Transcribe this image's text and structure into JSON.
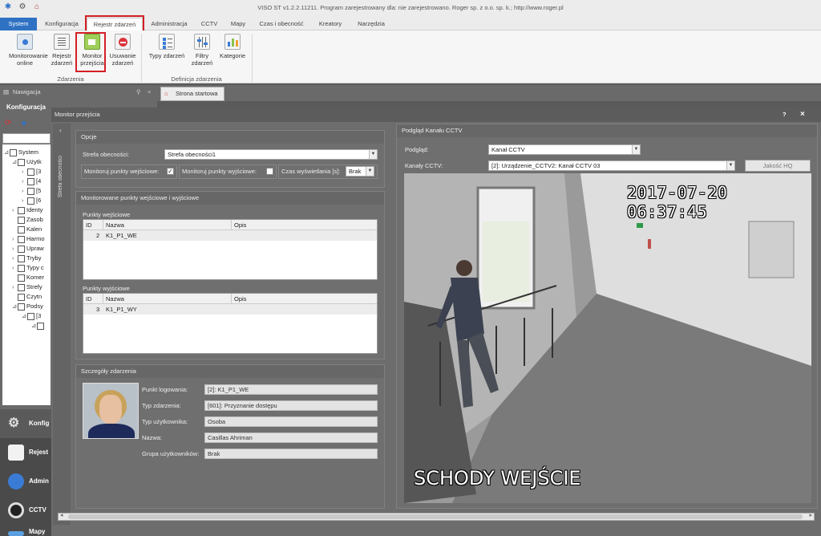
{
  "window": {
    "title": "VISO ST v1.2.2.11211. Program zarejestrowany dla: nie zarejestrowano. Roger sp. z o.o. sp. k.; http://www.roger.pl"
  },
  "menu": {
    "tabs": [
      "System",
      "Konfiguracja",
      "Rejestr zdarzeń",
      "Administracja",
      "CCTV",
      "Mapy",
      "Czas i obecność",
      "Kreatory",
      "Narzędzia"
    ]
  },
  "ribbon": {
    "buttons": [
      "Monitorowanie online",
      "Rejestr zdarzeń",
      "Monitor przejścia",
      "Usuwanie zdarzeń",
      "Typy zdarzeń",
      "Filtry zdarzeń",
      "Kategorie"
    ],
    "group1": "Zdarzenia",
    "group2": "Definicja zdarzenia"
  },
  "nav": {
    "title": "Nawigacja",
    "subtitle": "Konfiguracja",
    "tree": [
      "System",
      "Użytk",
      "[3",
      "[4",
      "[5",
      "[6",
      "Identy",
      "Zasob",
      "Kalen",
      "Harmo",
      "Upraw",
      "Tryby",
      "Typy c",
      "Komer",
      "Strefy",
      "Czytn",
      "Podsy",
      "[3",
      ""
    ],
    "buttons": [
      "Konfig",
      "Rejest",
      "Admin",
      "CCTV",
      "Mapy"
    ]
  },
  "doc_tab": "Strona startowa",
  "dialog": {
    "title": "Monitor przejścia",
    "help": "?",
    "close": "×",
    "side_label": "Strefa obecności",
    "options": {
      "header": "Opcje",
      "zone_label": "Strefa obecności:",
      "zone_value": "Strefa obecności1",
      "monitor_in_label": "Monitoruj punkty wejściowe:",
      "monitor_in_checked": "✓",
      "monitor_out_label": "Monitoruj punkty wyjściowe:",
      "display_time_label": "Czas wyświetlania [s]:",
      "display_time_value": "Brak"
    },
    "monitored": {
      "header": "Monitorowane punkty wejściowe i wyjściowe",
      "entry_title": "Punkty wejściowe",
      "exit_title": "Punkty wyjściowe",
      "columns": [
        "ID",
        "Nazwa",
        "Opis"
      ],
      "entry_rows": [
        {
          "id": "2",
          "name": "K1_P1_WE",
          "desc": ""
        }
      ],
      "exit_rows": [
        {
          "id": "3",
          "name": "K1_P1_WY",
          "desc": ""
        }
      ]
    },
    "details": {
      "header": "Szczegóły zdarzenia",
      "fields": [
        {
          "label": "Punkt logowania:",
          "value": "[2]: K1_P1_WE"
        },
        {
          "label": "Typ zdarzenia:",
          "value": "[601]: Przyznanie dostępu"
        },
        {
          "label": "Typ użytkownika:",
          "value": "Osoba"
        },
        {
          "label": "Nazwa:",
          "value": "Casillas Ahriman"
        },
        {
          "label": "Grupa użytkowników:",
          "value": "Brak"
        }
      ]
    },
    "cctv": {
      "header": "Podgląd Kanału CCTV",
      "preview_label": "Podgląd:",
      "preview_value": "Kanał CCTV",
      "channel_label": "Kanały CCTV:",
      "channel_value": "[2]: Urządzenie_CCTV2: Kanał CCTV 03",
      "hq_button": "Jakość HQ",
      "timestamp": "2017-07-20 06:37:45",
      "caption": "SCHODY WEJŚCIE"
    }
  }
}
